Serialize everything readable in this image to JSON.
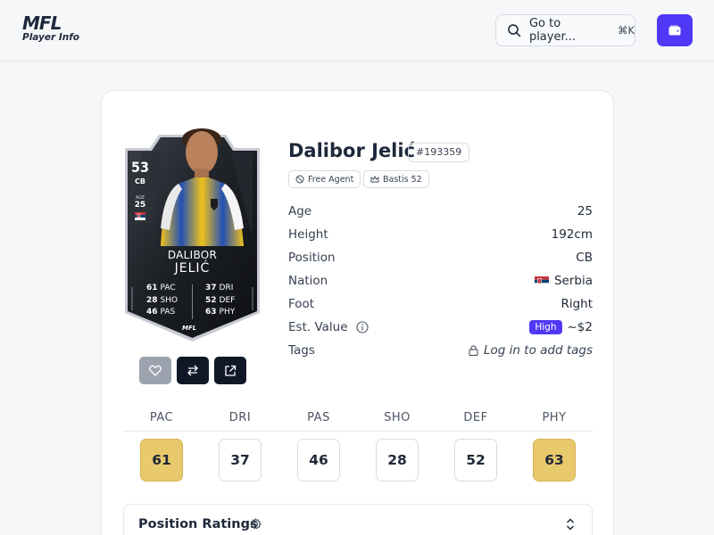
{
  "header": {
    "logo_text": "MFL",
    "logo_subtitle": "Player Info",
    "search_label": "Go to player...",
    "search_shortcut": "⌘K",
    "wallet_icon": "wallet-icon"
  },
  "card": {
    "overall": "53",
    "position": "CB",
    "age_label": "AGE",
    "age": "25",
    "first_name": "DALIBOR",
    "last_name": "JELIĆ",
    "stats_left": [
      {
        "value": "61",
        "label": "PAC"
      },
      {
        "value": "28",
        "label": "SHO"
      },
      {
        "value": "46",
        "label": "PAS"
      }
    ],
    "stats_right": [
      {
        "value": "37",
        "label": "DRI"
      },
      {
        "value": "52",
        "label": "DEF"
      },
      {
        "value": "63",
        "label": "PHY"
      }
    ],
    "brand": "MFL"
  },
  "player": {
    "name": "Dalibor Jelić",
    "id": "#193359",
    "chips": [
      "Free Agent",
      "Bastis 52"
    ]
  },
  "info": [
    {
      "label": "Age",
      "value": "25"
    },
    {
      "label": "Height",
      "value": "192cm"
    },
    {
      "label": "Position",
      "value": "CB"
    },
    {
      "label": "Nation",
      "value": "Serbia"
    },
    {
      "label": "Foot",
      "value": "Right"
    },
    {
      "label": "Est. Value",
      "badge": "High",
      "value": "~$2"
    },
    {
      "label": "Tags",
      "value": "Log in to add tags"
    }
  ],
  "attributes": [
    {
      "label": "PAC",
      "value": "61",
      "highlight": true
    },
    {
      "label": "DRI",
      "value": "37",
      "highlight": false
    },
    {
      "label": "PAS",
      "value": "46",
      "highlight": false
    },
    {
      "label": "SHO",
      "value": "28",
      "highlight": false
    },
    {
      "label": "DEF",
      "value": "52",
      "highlight": false
    },
    {
      "label": "PHY",
      "value": "63",
      "highlight": true
    }
  ],
  "position_ratings": {
    "title": "Position Ratings"
  },
  "colors": {
    "accent": "#4f39f6",
    "highlight": "#e8c96b",
    "dark": "#101828"
  }
}
